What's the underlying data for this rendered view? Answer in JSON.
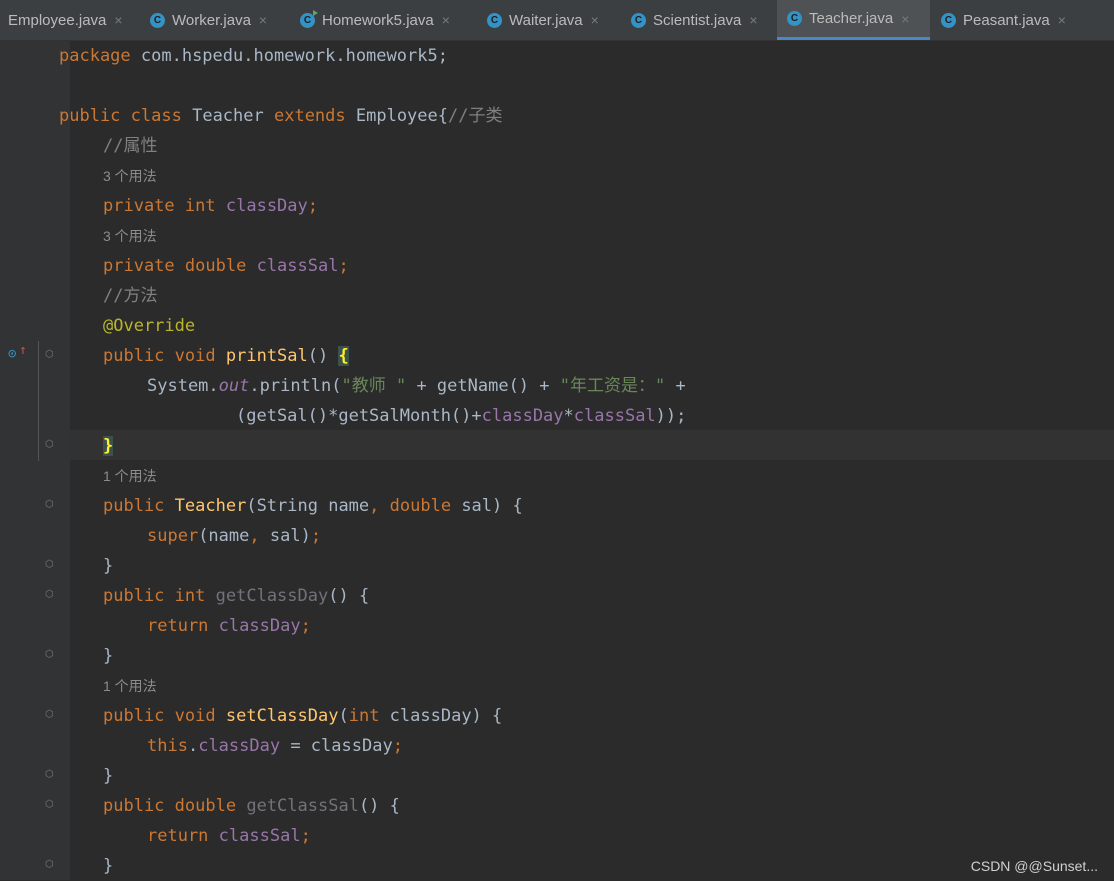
{
  "tabs": [
    {
      "label": "Employee.java",
      "active": false
    },
    {
      "label": "Worker.java",
      "active": false
    },
    {
      "label": "Homework5.java",
      "active": false
    },
    {
      "label": "Waiter.java",
      "active": false
    },
    {
      "label": "Scientist.java",
      "active": false
    },
    {
      "label": "Teacher.java",
      "active": true
    },
    {
      "label": "Peasant.java",
      "active": false
    }
  ],
  "tab_icon_letter": "C",
  "close_glyph": "×",
  "code": {
    "l1": {
      "kw": "package",
      "rest": " com.hspedu.homework.homework5;"
    },
    "l3": {
      "kw1": "public",
      "kw2": "class",
      "name": " Teacher ",
      "kw3": "extends",
      "rest": " Employee{",
      "comment": "//子类"
    },
    "l4": {
      "comment": "//属性"
    },
    "hint_3": "3 个用法",
    "hint_1": "1 个用法",
    "l6": {
      "kw1": "private",
      "kw2": "int",
      "field": "classDay",
      "end": ";"
    },
    "l8": {
      "kw1": "private",
      "kw2": "double",
      "field": "classSal",
      "end": ";"
    },
    "l9": {
      "comment": "//方法"
    },
    "l10": {
      "annotation": "@Override"
    },
    "l11": {
      "kw1": "public",
      "kw2": "void",
      "fn": "printSal",
      "rest": "() ",
      "brace": "{"
    },
    "l12": {
      "a": "System.",
      "out": "out",
      "b": ".println(",
      "s1": "\"教师 \"",
      "c": " + getName() + ",
      "s2": "\"年工资是：\"",
      "d": " +"
    },
    "l13": {
      "a": "(getSal()*getSalMonth()+",
      "f1": "classDay",
      "star": "*",
      "f2": "classSal",
      "b": "));"
    },
    "l14": {
      "brace": "}"
    },
    "l16": {
      "kw1": "public",
      "fn": "Teacher",
      "a": "(String name",
      "comma": ",",
      "kw2": "double",
      "b": " sal) {"
    },
    "l17": {
      "kw": "super",
      "a": "(name",
      "comma": ",",
      "b": " sal)",
      "end": ";"
    },
    "close": "}",
    "l19": {
      "kw1": "public",
      "kw2": "int",
      "fn": "getClassDay",
      "rest": "() {"
    },
    "l20": {
      "kw": "return",
      "field": "classDay",
      "end": ";"
    },
    "l23": {
      "kw1": "public",
      "kw2": "void",
      "fn": "setClassDay",
      "a": "(",
      "kw3": "int",
      "b": " classDay) {"
    },
    "l24": {
      "kw": "this",
      "a": ".",
      "field": "classDay",
      "b": " = classDay",
      "end": ";"
    },
    "l26": {
      "kw1": "public",
      "kw2": "double",
      "fn": "getClassSal",
      "rest": "() {"
    },
    "l27": {
      "kw": "return",
      "field": "classSal",
      "end": ";"
    }
  },
  "watermark": "CSDN @@Sunset...",
  "gutter_icons": [
    "override-icon",
    "fold-icon"
  ]
}
